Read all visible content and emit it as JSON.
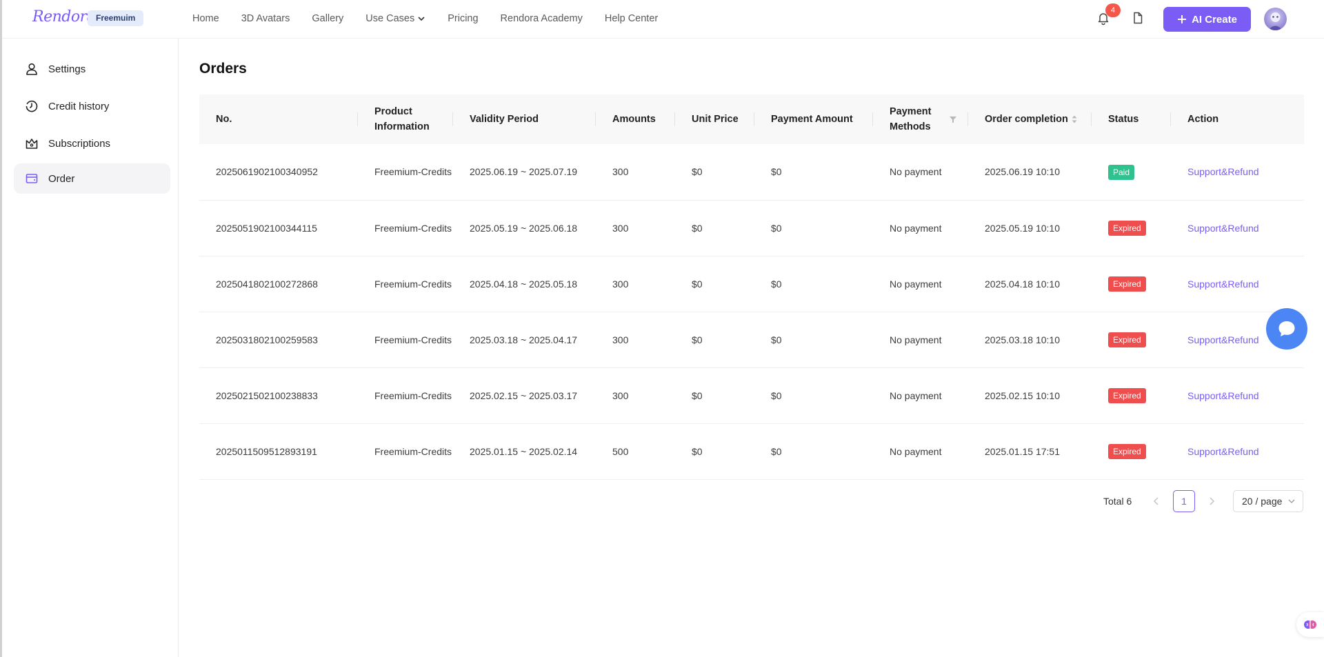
{
  "header": {
    "logo": "Rendora",
    "plan_badge": "Freemuim",
    "nav": [
      "Home",
      "3D Avatars",
      "Gallery",
      "Use Cases",
      "Pricing",
      "Rendora Academy",
      "Help Center"
    ],
    "notification_count": "4",
    "ai_create_label": "AI Create"
  },
  "sidebar": {
    "items": [
      {
        "label": "Settings",
        "icon": "user-icon"
      },
      {
        "label": "Credit history",
        "icon": "clock-icon"
      },
      {
        "label": "Subscriptions",
        "icon": "crown-icon"
      },
      {
        "label": "Order",
        "icon": "wallet-icon"
      }
    ],
    "active": "Order"
  },
  "page": {
    "title": "Orders"
  },
  "table": {
    "columns": [
      "No.",
      "Product Information",
      "Validity Period",
      "Amounts",
      "Unit Price",
      "Payment Amount",
      "Payment Methods",
      "Order completion",
      "Status",
      "Action"
    ],
    "rows": [
      {
        "no": "2025061902100340952",
        "product": "Freemium-Credits",
        "validity": "2025.06.19 ~ 2025.07.19",
        "amounts": "300",
        "unit_price": "$0",
        "payment_amount": "$0",
        "payment_method": "No payment",
        "completion": "2025.06.19 10:10",
        "status": "Paid",
        "action": "Support&Refund"
      },
      {
        "no": "2025051902100344115",
        "product": "Freemium-Credits",
        "validity": "2025.05.19 ~ 2025.06.18",
        "amounts": "300",
        "unit_price": "$0",
        "payment_amount": "$0",
        "payment_method": "No payment",
        "completion": "2025.05.19 10:10",
        "status": "Expired",
        "action": "Support&Refund"
      },
      {
        "no": "2025041802100272868",
        "product": "Freemium-Credits",
        "validity": "2025.04.18 ~ 2025.05.18",
        "amounts": "300",
        "unit_price": "$0",
        "payment_amount": "$0",
        "payment_method": "No payment",
        "completion": "2025.04.18 10:10",
        "status": "Expired",
        "action": "Support&Refund"
      },
      {
        "no": "2025031802100259583",
        "product": "Freemium-Credits",
        "validity": "2025.03.18 ~ 2025.04.17",
        "amounts": "300",
        "unit_price": "$0",
        "payment_amount": "$0",
        "payment_method": "No payment",
        "completion": "2025.03.18 10:10",
        "status": "Expired",
        "action": "Support&Refund"
      },
      {
        "no": "2025021502100238833",
        "product": "Freemium-Credits",
        "validity": "2025.02.15 ~ 2025.03.17",
        "amounts": "300",
        "unit_price": "$0",
        "payment_amount": "$0",
        "payment_method": "No payment",
        "completion": "2025.02.15 10:10",
        "status": "Expired",
        "action": "Support&Refund"
      },
      {
        "no": "2025011509512893191",
        "product": "Freemium-Credits",
        "validity": "2025.01.15 ~ 2025.02.14",
        "amounts": "500",
        "unit_price": "$0",
        "payment_amount": "$0",
        "payment_method": "No payment",
        "completion": "2025.01.15 17:51",
        "status": "Expired",
        "action": "Support&Refund"
      }
    ]
  },
  "pagination": {
    "total_label": "Total 6",
    "current_page": "1",
    "page_size": "20 / page"
  },
  "colors": {
    "accent": "#7b5cf5",
    "paid": "#2fc18e",
    "expired": "#ef4e4e",
    "chat": "#4c86f5"
  }
}
